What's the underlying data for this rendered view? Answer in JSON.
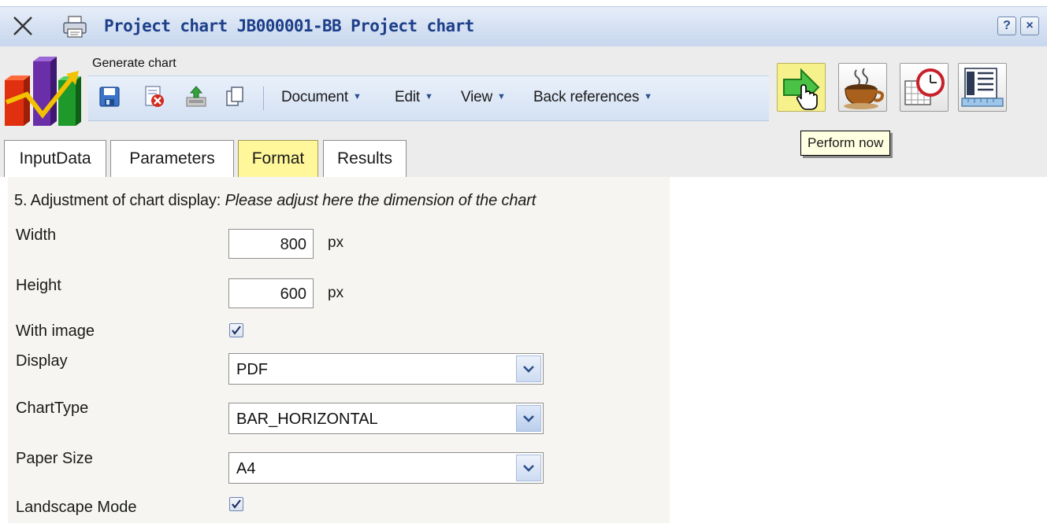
{
  "window": {
    "title": "Project chart JB000001-BB Project chart",
    "help_label": "?",
    "close_label": "×"
  },
  "toolbar": {
    "caption": "Generate chart",
    "menus": [
      {
        "label": "Document"
      },
      {
        "label": "Edit"
      },
      {
        "label": "View"
      },
      {
        "label": "Back references"
      }
    ],
    "tooltip": "Perform now"
  },
  "tabs": [
    {
      "label": "InputData",
      "active": false
    },
    {
      "label": "Parameters",
      "active": false
    },
    {
      "label": "Format",
      "active": true
    },
    {
      "label": "Results",
      "active": false
    }
  ],
  "form": {
    "heading_prefix": "5. Adjustment of chart display: ",
    "heading_hint": "Please adjust here the dimension of the chart",
    "width": {
      "label": "Width",
      "value": "800",
      "unit": "px"
    },
    "height": {
      "label": "Height",
      "value": "600",
      "unit": "px"
    },
    "with_image": {
      "label": "With image",
      "checked": true
    },
    "display": {
      "label": "Display",
      "value": "PDF"
    },
    "chart_type": {
      "label": "ChartType",
      "value": "BAR_HORIZONTAL"
    },
    "paper_size": {
      "label": "Paper Size",
      "value": "A4"
    },
    "landscape": {
      "label": "Landscape Mode",
      "checked": true
    }
  },
  "colors": {
    "title_text": "#1d3f8a",
    "active_tab": "#fff79a",
    "perform_button": "#f7f18c",
    "tooltip_bg": "#ffffe1"
  }
}
